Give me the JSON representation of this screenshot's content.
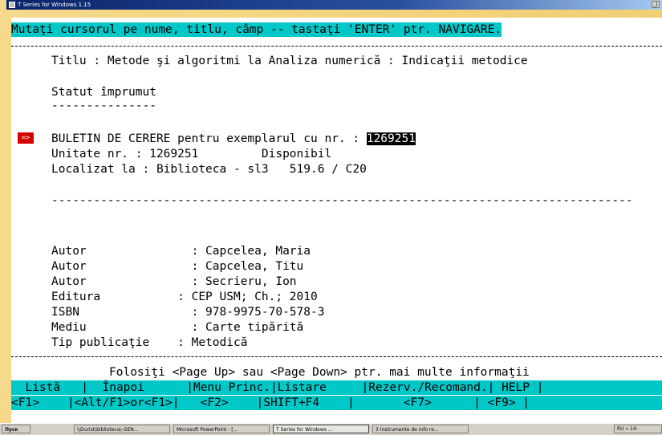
{
  "window": {
    "title": "T Series for Windows 1.15",
    "restore_glyph": "_|"
  },
  "screen": {
    "prompt": "Mutaţi cursorul pe nume, titlu, câmp -- tastaţi 'ENTER' ptr. NAVIGARE.",
    "title_line": "Titlu : Metode şi algoritmi la Analiza numerică : Indicaţii metodice",
    "loan_status_heading": "Statut împrumut",
    "heading_underline": "---------------",
    "cursor_marker": "=>",
    "request_label": "BULETIN DE CERERE pentru exemplarul cu nr. : ",
    "request_number": "1269251",
    "unit_line": "Unitate nr. : 1269251         Disponibil",
    "location_line": "Localizat la : Biblioteca - sl3   519.6 / C20",
    "separator_inner": "-----------------------------------------------------------------------------------",
    "fields": [
      "Autor               : Capcelea, Maria",
      "Autor               : Capcelea, Titu",
      "Autor               : Secrieru, Ion",
      "Editura           : CEP USM; Ch.; 2010",
      "ISBN                : 978-9975-70-578-3",
      "Mediu               : Carte tipărită",
      "Tip publicaţie    : Metodică"
    ],
    "footer_hint": "Folosiţi <Page Up> sau <Page Down> ptr. mai multe informaţii",
    "menu_labels": "  Listă   |  Înapoi      |Menu Princ.|Listare     |Rezerv./Recomand.| HELP |",
    "menu_keys": "<F1>    |<Alt/F1>or<F1>|   <F2>    |SHIFT+F4    |       <F7>      | <F9> |"
  },
  "taskbar": {
    "start_label": "Пуск",
    "items": [
      "\\\\Durist\\biblioteca\\-GEN...",
      "Microsoft PowerPoint - [...",
      "T Series for Windows ...",
      "3 Instrumente de info re..."
    ],
    "tray_text": "RU « 14:"
  }
}
